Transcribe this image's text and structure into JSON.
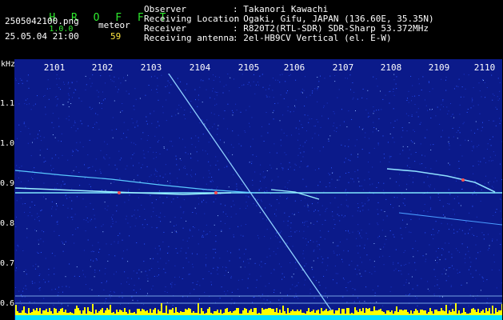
{
  "app": {
    "brand": "H R O F F T",
    "version": "1.0.0",
    "filename": "2505042100.png",
    "datetime": "25.05.04 21:00",
    "meteor_label": "meteor",
    "meteor_count": "59"
  },
  "info": {
    "labels": [
      "Observer",
      "Receiving Location",
      "Receiver",
      "Receiving antenna"
    ],
    "values": [
      ": Takanori Kawachi",
      ": Ogaki, Gifu, JAPAN (136.60E, 35.35N)",
      ": R820T2(RTL-SDR) SDR-Sharp 53.372MHz",
      ": 2el-HB9CV Vertical (el. E-W)"
    ]
  },
  "axes": {
    "y_unit": "kHz",
    "y_ticks": [
      "1.1",
      "1.0",
      "0.9",
      "0.8",
      "0.7",
      "0.6"
    ],
    "x_ticks": [
      "2101",
      "2102",
      "2103",
      "2104",
      "2105",
      "2106",
      "2107",
      "2108",
      "2109",
      "2110"
    ]
  },
  "colors": {
    "background": "#0b1a8a",
    "noise": "#2a55ff",
    "signal": "#7fe8ff",
    "hot": "#ff5050",
    "strip_top": "#ffff00",
    "strip_bottom": "#00e0ff"
  }
}
